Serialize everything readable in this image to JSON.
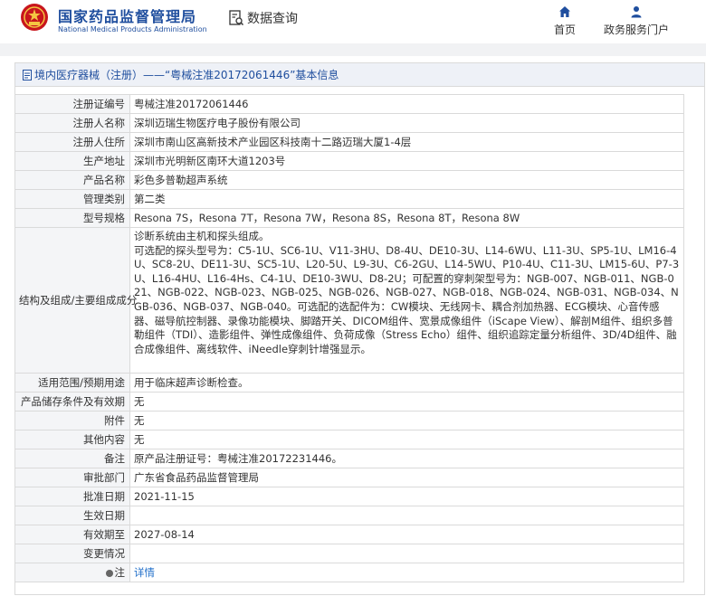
{
  "header": {
    "org_name_cn": "国家药品监督管理局",
    "org_name_en": "National Medical Products Administration",
    "query_label": "数据查询",
    "nav": [
      {
        "label": "首页",
        "icon": "home-icon"
      },
      {
        "label": "政务服务门户",
        "icon": "user-icon"
      }
    ]
  },
  "panel": {
    "title": "境内医疗器械（注册）——“粤械注准20172061446”基本信息"
  },
  "rows": [
    {
      "label": "注册证编号",
      "value": "粤械注准20172061446"
    },
    {
      "label": "注册人名称",
      "value": "深圳迈瑞生物医疗电子股份有限公司"
    },
    {
      "label": "注册人住所",
      "value": "深圳市南山区高新技术产业园区科技南十二路迈瑞大厦1-4层"
    },
    {
      "label": "生产地址",
      "value": "深圳市光明新区南环大道1203号"
    },
    {
      "label": "产品名称",
      "value": "彩色多普勒超声系统"
    },
    {
      "label": "管理类别",
      "value": "第二类"
    },
    {
      "label": "型号规格",
      "value": "Resona 7S，Resona 7T，Resona 7W，Resona 8S，Resona 8T，Resona 8W"
    },
    {
      "label": "结构及组成/主要组成成分",
      "value": "诊断系统由主机和探头组成。\n可选配的探头型号为：C5-1U、SC6-1U、V11-3HU、D8-4U、DE10-3U、L14-6WU、L11-3U、SP5-1U、LM16-4U、SC8-2U、DE11-3U、SC5-1U、L20-5U、L9-3U、C6-2GU、L14-5WU、P10-4U、C11-3U、LM15-6U、P7-3U、L16-4HU、L16-4Hs、C4-1U、DE10-3WU、D8-2U；可配置的穿刺架型号为：NGB-007、NGB-011、NGB-021、NGB-022、NGB-023、NGB-025、NGB-026、NGB-027、NGB-018、NGB-024、NGB-031、NGB-034、NGB-036、NGB-037、NGB-040。可选配的选配件为：CW模块、无线网卡、耦合剂加热器、ECG模块、心音传感器、磁导航控制器、录像功能模块、脚踏开关、DICOM组件、宽景成像组件（iScape View）、解剖M组件、组织多普勒组件（TDI）、造影组件、弹性成像组件、负荷成像（Stress Echo）组件、组织追踪定量分析组件、3D/4D组件、融合成像组件、离线软件、iNeedle穿刺针增强显示。"
    },
    {
      "label": "适用范围/预期用途",
      "value": "用于临床超声诊断检查。"
    },
    {
      "label": "产品储存条件及有效期",
      "value": "无"
    },
    {
      "label": "附件",
      "value": "无"
    },
    {
      "label": "其他内容",
      "value": "无"
    },
    {
      "label": "备注",
      "value": "原产品注册证号：粤械注准20172231446。"
    },
    {
      "label": "审批部门",
      "value": "广东省食品药品监督管理局"
    },
    {
      "label": "批准日期",
      "value": "2021-11-15"
    },
    {
      "label": "生效日期",
      "value": ""
    },
    {
      "label": "有效期至",
      "value": "2027-08-14"
    },
    {
      "label": "变更情况",
      "value": ""
    }
  ],
  "note_row": {
    "label": "注",
    "link": "详情",
    "icon": "note-icon"
  }
}
